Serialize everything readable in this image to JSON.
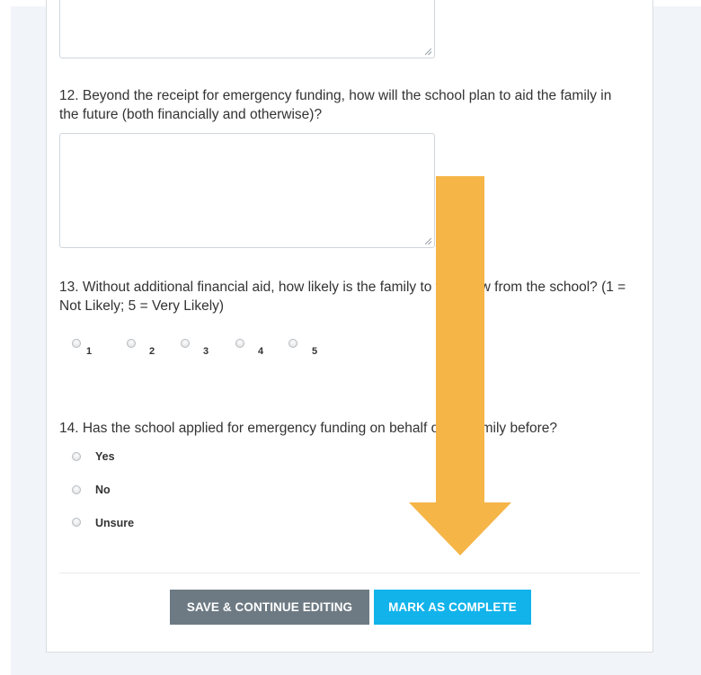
{
  "form": {
    "q11": {
      "answer": ""
    },
    "q12": {
      "text": "12. Beyond the receipt for emergency funding, how will the school plan to aid the family in the future (both financially and otherwise)?",
      "answer": ""
    },
    "q13": {
      "text": "13. Without additional financial aid, how likely is the family to withdraw from the school? (1 = Not Likely; 5 = Very Likely)",
      "options": [
        "1",
        "2",
        "3",
        "4",
        "5"
      ]
    },
    "q14": {
      "text": "14. Has the school applied for emergency funding on behalf of the family before?",
      "options": [
        "Yes",
        "No",
        "Unsure"
      ]
    }
  },
  "buttons": {
    "save_label": "SAVE & CONTINUE EDITING",
    "complete_label": "MARK AS COMPLETE"
  },
  "annotation": {
    "arrow_color": "#f5b547",
    "arrow_direction": "down"
  },
  "colors": {
    "save_button": "#6d7a83",
    "complete_button": "#12b3ea",
    "page_background": "#f1f4f8"
  }
}
